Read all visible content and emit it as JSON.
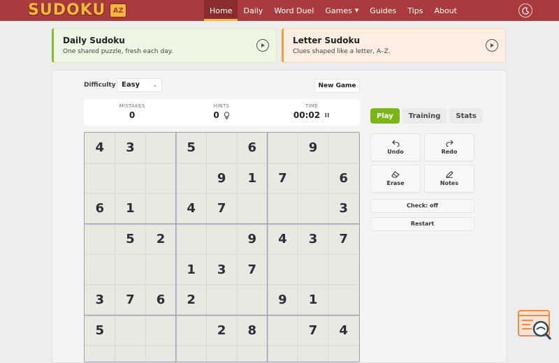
{
  "header": {
    "logo_text": "SUDOKU",
    "logo_badge": "AZ",
    "nav": [
      {
        "label": "Home",
        "active": true
      },
      {
        "label": "Daily",
        "active": false
      },
      {
        "label": "Word Duel",
        "active": false
      },
      {
        "label": "Games",
        "active": false,
        "dropdown": true
      },
      {
        "label": "Guides",
        "active": false
      },
      {
        "label": "Tips",
        "active": false
      },
      {
        "label": "About",
        "active": false
      }
    ],
    "theme_icon": "moon-icon"
  },
  "promos": [
    {
      "title": "Daily Sudoku",
      "subtitle": "One shared puzzle, fresh each day.",
      "accent": "#86b93a"
    },
    {
      "title": "Letter Sudoku",
      "subtitle": "Clues shaped like a letter, A–Z.",
      "accent": "#f0a04b"
    }
  ],
  "controls": {
    "difficulty_label": "Difficulty",
    "difficulty_value": "Easy",
    "new_game_label": "New Game"
  },
  "stats": {
    "mistakes_label": "MISTAKES",
    "mistakes_value": "0",
    "hints_label": "HINTS",
    "hints_value": "0",
    "time_label": "TIME",
    "time_value": "00:02"
  },
  "board": {
    "rows": [
      [
        "4",
        "3",
        "",
        "5",
        "",
        "6",
        "",
        "9",
        ""
      ],
      [
        "",
        "",
        "",
        "",
        "9",
        "1",
        "7",
        "",
        "6"
      ],
      [
        "6",
        "1",
        "",
        "4",
        "7",
        "",
        "",
        "",
        "3"
      ],
      [
        "",
        "5",
        "2",
        "",
        "",
        "9",
        "4",
        "3",
        "7"
      ],
      [
        "",
        "",
        "",
        "1",
        "3",
        "7",
        "",
        "",
        ""
      ],
      [
        "3",
        "7",
        "6",
        "2",
        "",
        "",
        "9",
        "1",
        ""
      ],
      [
        "5",
        "",
        "",
        "",
        "2",
        "8",
        "",
        "7",
        "4"
      ]
    ]
  },
  "side": {
    "tabs": [
      {
        "label": "Play",
        "active": true
      },
      {
        "label": "Training",
        "active": false
      },
      {
        "label": "Stats",
        "active": false
      }
    ],
    "tools": {
      "undo": "Undo",
      "redo": "Redo",
      "erase": "Erase",
      "notes": "Notes"
    },
    "check_label": "Check: off",
    "restart_label": "Restart"
  },
  "colors": {
    "header_bg": "#a93a3d",
    "logo_yellow": "#f6b73c",
    "play_green": "#7cb518"
  }
}
